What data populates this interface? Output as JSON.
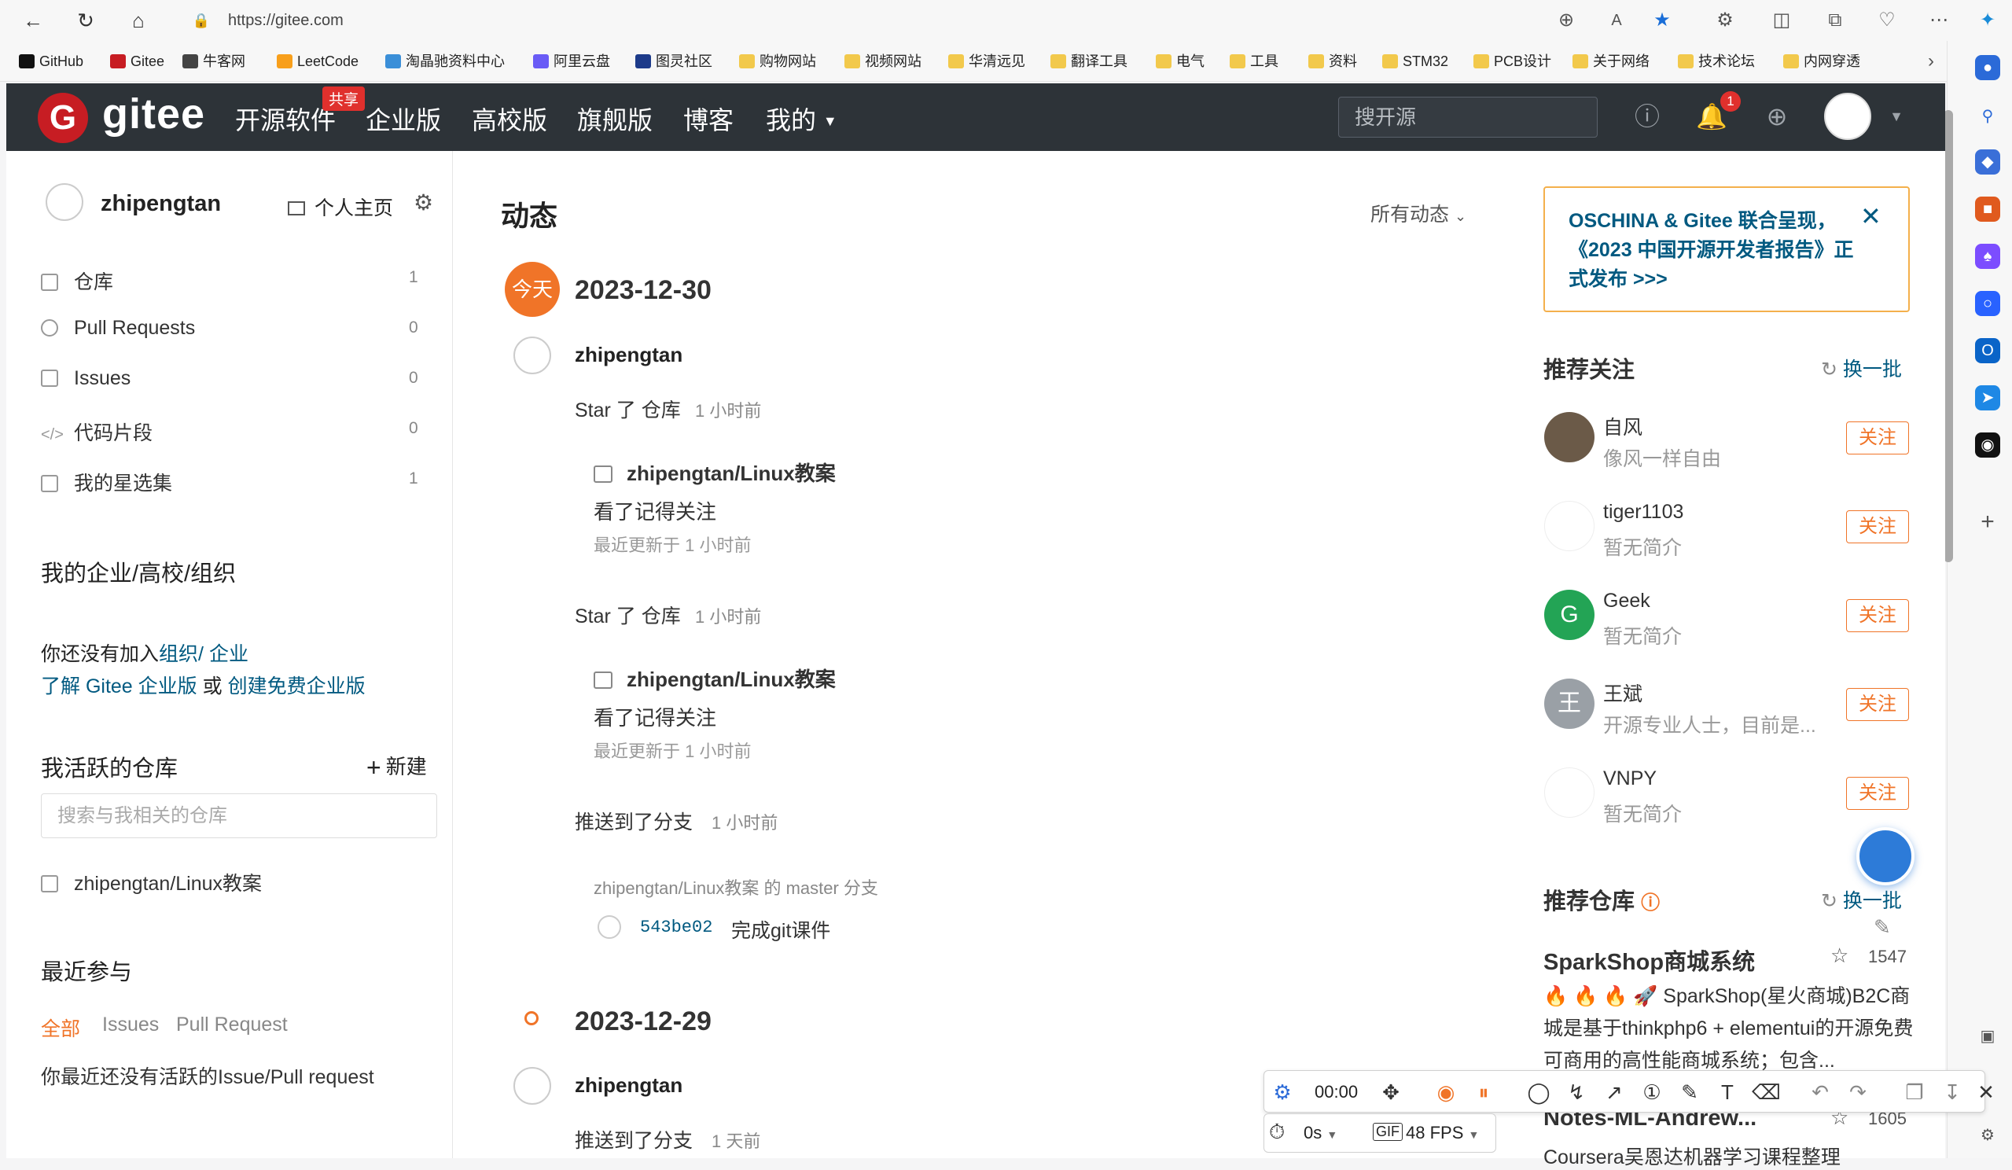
{
  "browser": {
    "url": "https://gitee.com",
    "bookmarks": [
      "GitHub",
      "Gitee",
      "牛客网",
      "LeetCode",
      "淘晶驰资料中心",
      "阿里云盘",
      "图灵社区",
      "购物网站",
      "视频网站",
      "华清远见",
      "翻译工具",
      "电气",
      "工具",
      "资料",
      "STM32",
      "PCB设计",
      "关于网络",
      "技术论坛",
      "内网穿透"
    ]
  },
  "header": {
    "logo_mark": "G",
    "logo_text": "gitee",
    "nav": [
      "开源软件",
      "企业版",
      "高校版",
      "旗舰版",
      "博客",
      "我的"
    ],
    "share_badge": "共享",
    "search_placeholder": "搜开源",
    "notification_count": "1"
  },
  "sidebar": {
    "username": "zhipengtan",
    "home_label": "个人主页",
    "items": [
      {
        "label": "仓库",
        "count": "1"
      },
      {
        "label": "Pull Requests",
        "count": "0"
      },
      {
        "label": "Issues",
        "count": "0"
      },
      {
        "label": "代码片段",
        "count": "0"
      },
      {
        "label": "我的星选集",
        "count": "1"
      }
    ],
    "org_title": "我的企业/高校/组织",
    "org_text_1": "你还没有加入",
    "org_link_1": "组织",
    "org_sep": "/ ",
    "org_link_2": "企业",
    "org_link_3": "了解 Gitee 企业版",
    "org_or": " 或 ",
    "org_link_4": "创建免费企业版",
    "active_title": "我活跃的仓库",
    "new_label": "新建",
    "repo_search_placeholder": "搜索与我相关的仓库",
    "active_repo": "zhipengtan/Linux教案",
    "recent_title": "最近参与",
    "recent_tabs": [
      "全部",
      "Issues",
      "Pull Request"
    ],
    "recent_empty": "你最近还没有活跃的Issue/Pull request"
  },
  "feed": {
    "title": "动态",
    "filter_label": "所有动态",
    "today_badge": "今天",
    "date_1": "2023-12-30",
    "user": "zhipengtan",
    "events": [
      {
        "action": "Star 了 仓库",
        "time": "1 小时前",
        "repo": "zhipengtan/Linux教案",
        "desc": "看了记得关注",
        "updated": "最近更新于 1 小时前"
      },
      {
        "action": "Star 了 仓库",
        "time": "1 小时前",
        "repo": "zhipengtan/Linux教案",
        "desc": "看了记得关注",
        "updated": "最近更新于 1 小时前"
      }
    ],
    "push_action": "推送到了分支",
    "push_time": "1 小时前",
    "push_branch": "zhipengtan/Linux教案 的 master 分支",
    "commit_hash": "543be02",
    "commit_msg": "完成git课件",
    "date_2": "2023-12-29",
    "user_2": "zhipengtan",
    "push_action_2": "推送到了分支",
    "push_time_2": "1 天前"
  },
  "right": {
    "banner": "OSCHINA & Gitee 联合呈现，《2023 中国开源开发者报告》正式发布 >>>",
    "follow_title": "推荐关注",
    "refresh_label": "换一批",
    "follow_btn": "关注",
    "users": [
      {
        "name": "自风",
        "bio": "像风一样自由",
        "avatar_color": "#6b5a48",
        "initial": ""
      },
      {
        "name": "tiger1103",
        "bio": "暂无简介",
        "avatar_color": "#ffffff",
        "initial": ""
      },
      {
        "name": "Geek",
        "bio": "暂无简介",
        "avatar_color": "#23a455",
        "initial": "G"
      },
      {
        "name": "王斌",
        "bio": "开源专业人士，目前是...",
        "avatar_color": "#9aa0a6",
        "initial": "王"
      },
      {
        "name": "VNPY",
        "bio": "暂无简介",
        "avatar_color": "#ffffff",
        "initial": ""
      }
    ],
    "repo_title": "推荐仓库",
    "repo_refresh": "换一批",
    "repo_1_name": "SparkShop商城系统",
    "repo_1_stars": "1547",
    "repo_1_desc": "🔥 🔥 🔥 🚀 SparkShop(星火商城)B2C商城是基于thinkphp6 + elementui的开源免费可商用的高性能商城系统；包含...",
    "repo_2_name": "Notes-ML-Andrew...",
    "repo_2_stars": "1605",
    "repo_2_desc": "Coursera吴恩达机器学习课程整理"
  },
  "recorder": {
    "time": "00:00",
    "delay": "0s",
    "format": "GIF",
    "fps": "48 FPS"
  }
}
